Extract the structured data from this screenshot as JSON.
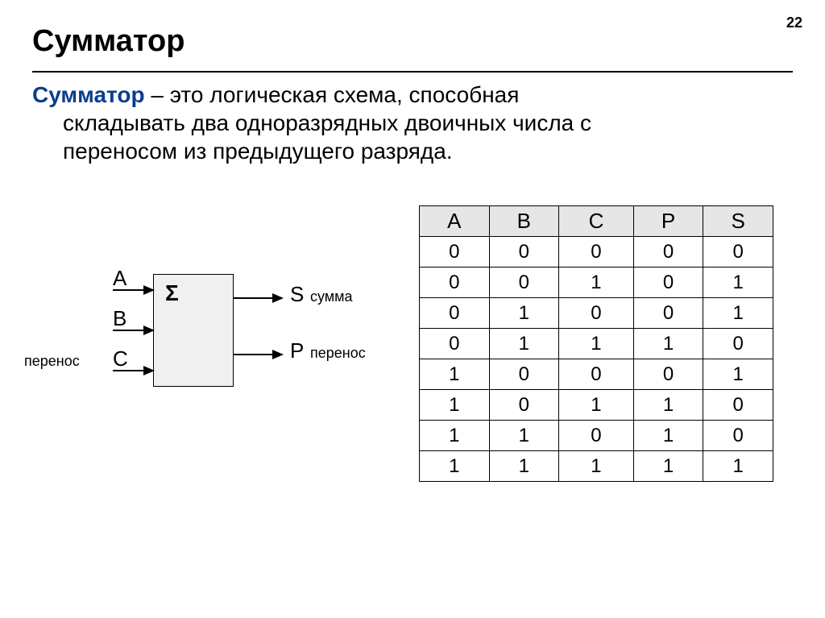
{
  "page_number": "22",
  "title": "Сумматор",
  "definition": {
    "term": "Сумматор",
    "line1_rest": " – это логическая схема, способная",
    "line2": "складывать два одноразрядных двоичных числа с",
    "line3": "переносом из предыдущего разряда."
  },
  "diagram": {
    "sigma": "Σ",
    "inputs": {
      "A": "A",
      "B": "B",
      "C": "C"
    },
    "carry_in_label": "перенос",
    "outputs": {
      "S": "S",
      "S_desc": "сумма",
      "P": "P",
      "P_desc": "перенос"
    }
  },
  "truth_table": {
    "headers": [
      "A",
      "B",
      "C",
      "P",
      "S"
    ],
    "rows": [
      [
        "0",
        "0",
        "0",
        "0",
        "0"
      ],
      [
        "0",
        "0",
        "1",
        "0",
        "1"
      ],
      [
        "0",
        "1",
        "0",
        "0",
        "1"
      ],
      [
        "0",
        "1",
        "1",
        "1",
        "0"
      ],
      [
        "1",
        "0",
        "0",
        "0",
        "1"
      ],
      [
        "1",
        "0",
        "1",
        "1",
        "0"
      ],
      [
        "1",
        "1",
        "0",
        "1",
        "0"
      ],
      [
        "1",
        "1",
        "1",
        "1",
        "1"
      ]
    ]
  }
}
